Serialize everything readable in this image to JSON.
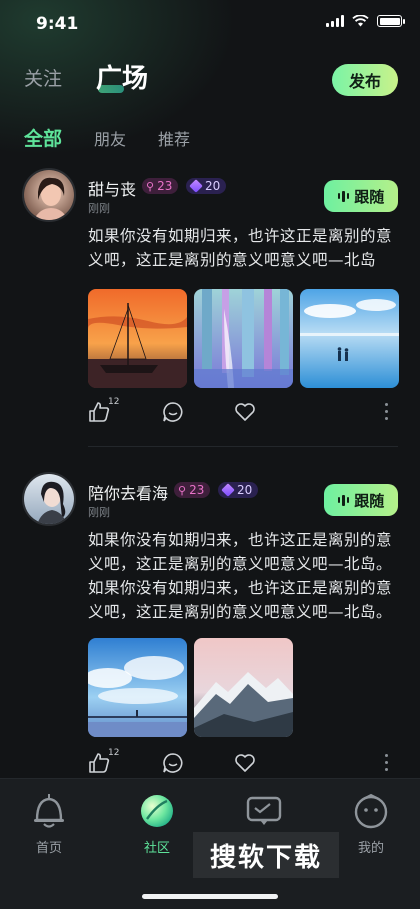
{
  "status_bar": {
    "time": "9:41"
  },
  "header": {
    "follow_tab": "关注",
    "square_tab": "广场",
    "publish_label": "发布"
  },
  "sub_tabs": [
    {
      "label": "全部",
      "active": true
    },
    {
      "label": "朋友",
      "active": false
    },
    {
      "label": "推荐",
      "active": false
    }
  ],
  "posts": [
    {
      "username": "甜与丧",
      "badge_level": "23",
      "badge_gem": "20",
      "time": "刚刚",
      "follow_label": "跟随",
      "text": "如果你没有如期归来，也许这正是离别的意义吧，这正是离别的意义吧意义吧—北岛",
      "likes": "12",
      "photos": [
        "sunset-sailboat",
        "pastel-forest",
        "beach-couple"
      ]
    },
    {
      "username": "陪你去看海",
      "badge_level": "23",
      "badge_gem": "20",
      "time": "刚刚",
      "follow_label": "跟随",
      "text": "如果你没有如期归来，也许这正是离别的意义吧，这正是离别的意义吧意义吧—北岛。如果你没有如期归来，也许这正是离别的意义吧，这正是离别的意义吧意义吧—北岛。",
      "likes": "12",
      "photos": [
        "sky-pier",
        "snowy-mountains"
      ]
    }
  ],
  "tabbar": {
    "items": [
      {
        "label": "首页",
        "icon": "bell-icon"
      },
      {
        "label": "社区",
        "icon": "planet-icon",
        "active": true
      },
      {
        "label": "消息",
        "icon": "message-tv-icon"
      },
      {
        "label": "我的",
        "icon": "face-icon"
      }
    ]
  },
  "watermark": "搜软下载",
  "colors": {
    "accent": "#5ee39a",
    "background": "#121416",
    "badge_pink": "#e873c8",
    "badge_purple": "#d9ccff"
  }
}
